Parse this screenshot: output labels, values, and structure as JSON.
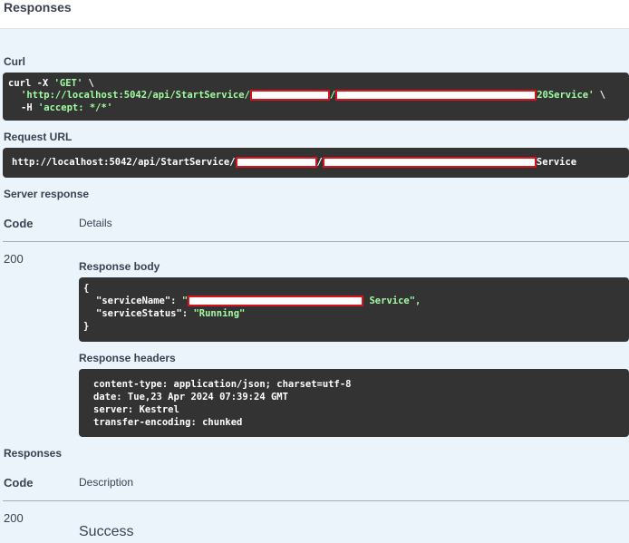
{
  "header": {
    "title": "Responses"
  },
  "curl": {
    "label": "Curl",
    "line1_prefix": "curl -X ",
    "line1_method": "'GET'",
    "line1_suffix": " \\",
    "line2_prefix": "'http://localhost:5042/api/StartService/",
    "line2_sep": "/",
    "line2_suffix": "20Service'",
    "line2_end": " \\",
    "line3_prefix": "-H ",
    "line3_value": "'accept: */*'"
  },
  "request_url": {
    "label": "Request URL",
    "prefix": "http://localhost:5042/api/StartService/",
    "sep": "/",
    "suffix": "Service"
  },
  "server_response": {
    "label": "Server response",
    "col_code": "Code",
    "col_details": "Details",
    "status": "200",
    "body_label": "Response body",
    "body_open": "{",
    "body_key1": "\"serviceName\": ",
    "body_val1_open": "\"",
    "body_val1_tail": " Service\",",
    "body_key2": "\"serviceStatus\": ",
    "body_val2": "\"Running\"",
    "body_close": "}",
    "headers_label": "Response headers",
    "headers": [
      "content-type: application/json; charset=utf-8",
      "date: Tue,23 Apr 2024 07:39:24 GMT",
      "server: Kestrel",
      "transfer-encoding: chunked"
    ]
  },
  "responses": {
    "label": "Responses",
    "col_code": "Code",
    "col_description": "Description",
    "status": "200",
    "description": "Success"
  }
}
